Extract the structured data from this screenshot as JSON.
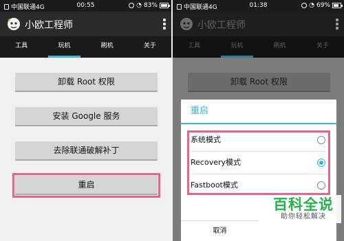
{
  "left": {
    "status": {
      "carrier": "中国联通4G",
      "time": "00:55",
      "battery": "83%",
      "battery_level": 0.83
    },
    "app": {
      "title": "小欧工程师"
    },
    "tabs": [
      {
        "label": "工具",
        "active": false
      },
      {
        "label": "玩机",
        "active": true
      },
      {
        "label": "刷机",
        "active": false
      },
      {
        "label": "关于",
        "active": false
      }
    ],
    "buttons": [
      {
        "label": "卸载 Root 权限"
      },
      {
        "label": "安装 Google 服务"
      },
      {
        "label": "去除联通破解补丁"
      },
      {
        "label": "重启",
        "highlighted": true
      }
    ]
  },
  "right": {
    "status": {
      "carrier": "中国联通4G",
      "time": "01:38",
      "battery": "69%",
      "battery_level": 0.69
    },
    "app": {
      "title": "小欧工程师"
    },
    "tabs": [
      {
        "label": "工具",
        "active": false
      },
      {
        "label": "玩机",
        "active": true
      },
      {
        "label": "刷机",
        "active": false
      },
      {
        "label": "关于",
        "active": false
      }
    ],
    "background_button": {
      "label": "卸载 Root 权限"
    },
    "dialog": {
      "title": "重启",
      "options": [
        {
          "label": "系统模式",
          "checked": false
        },
        {
          "label": "Recovery模式",
          "checked": true
        },
        {
          "label": "Fastboot模式",
          "checked": false
        }
      ],
      "cancel_label": "取消"
    }
  },
  "watermark": {
    "title": "百科全说",
    "subtitle": "助你轻松解决"
  },
  "colors": {
    "accent": "#33b5e5",
    "highlight_frame": "#e8648c",
    "watermark_green": "#26b34b"
  }
}
